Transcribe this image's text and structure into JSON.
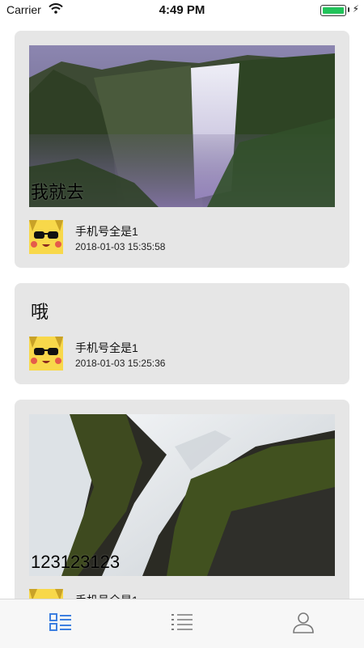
{
  "status_bar": {
    "carrier": "Carrier",
    "time": "4:49 PM",
    "battery_level": 1.0
  },
  "posts": [
    {
      "caption": "我就去",
      "author": "手机号全是1",
      "timestamp": "2018-01-03 15:35:58",
      "image": "waterfall-landscape"
    },
    {
      "text": "哦",
      "author": "手机号全是1",
      "timestamp": "2018-01-03 15:25:36"
    },
    {
      "caption": "123123123",
      "author": "手机号全是1",
      "image": "waterfall-closeup"
    }
  ],
  "tab_bar": {
    "tabs": [
      {
        "icon": "list-icon",
        "active": true
      },
      {
        "icon": "menu-list-icon",
        "active": false
      },
      {
        "icon": "profile-icon",
        "active": false
      }
    ],
    "accent_color": "#3d7fe0",
    "inactive_color": "#7a7a7a"
  }
}
